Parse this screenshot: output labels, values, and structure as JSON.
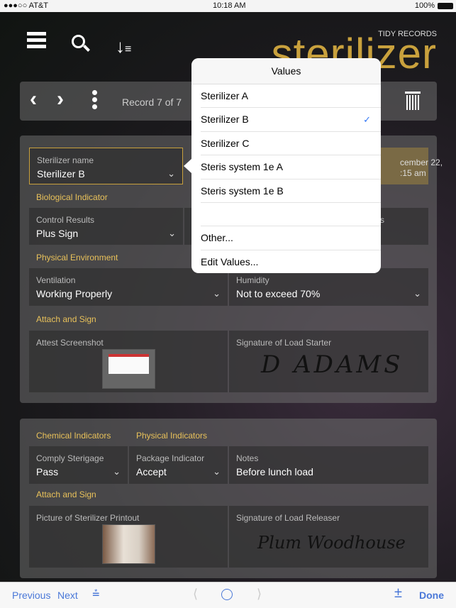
{
  "status_bar": {
    "carrier": "●●●○○ AT&T",
    "time": "10:18 AM",
    "battery": "100%"
  },
  "header": {
    "logo_small": "TIDY RECORDS",
    "logo_big": "sterilizer",
    "icons": [
      "menu-icon",
      "search-icon",
      "sort-icon"
    ]
  },
  "toolbar": {
    "record_text": "Record 7 of 7"
  },
  "record1": {
    "sterilizer_name": {
      "label": "Sterilizer name",
      "value": "Sterilizer B"
    },
    "date_fragment_1": "cember 22,",
    "date_fragment_2": ":15 am",
    "bio_section": "Biological Indicator",
    "control_results": {
      "label": "Control Results",
      "value": "Plus Sign"
    },
    "hidden_label_fragment": "s",
    "phys_section": "Physical Environment",
    "ventilation": {
      "label": "Ventilation",
      "value": "Working Properly"
    },
    "humidity": {
      "label": "Humidity",
      "value": "Not to exceed  70%"
    },
    "attach_section": "Attach and Sign",
    "attest": {
      "label": "Attest Screenshot"
    },
    "signature_starter": {
      "label": "Signature of Load Starter",
      "signature": "D ADAMS"
    }
  },
  "record2": {
    "chem_section": "Chemical Indicators",
    "phys_section": "Physical Indicators",
    "comply": {
      "label": "Comply Sterigage",
      "value": "Pass"
    },
    "package": {
      "label": "Package Indicator",
      "value": "Accept"
    },
    "notes": {
      "label": "Notes",
      "value": "Before lunch load"
    },
    "attach_section": "Attach and Sign",
    "printout": {
      "label": "Picture of Sterilizer Printout"
    },
    "signature_releaser": {
      "label": "Signature of Load Releaser",
      "signature": "Plum Woodhouse"
    }
  },
  "popover": {
    "title": "Values",
    "items": [
      "Sterilizer A",
      "Sterilizer B",
      "Sterilizer C",
      "Steris system 1e A",
      "Steris system 1e B",
      "",
      "Other...",
      "Edit Values..."
    ],
    "selected": "Sterilizer B",
    "check": "✓"
  },
  "bottom_bar": {
    "previous": "Previous",
    "next": "Next",
    "done": "Done"
  },
  "colors": {
    "accent": "#c9a13d",
    "section": "#e8c15a",
    "link": "#4a78d8",
    "check": "#3478f6"
  }
}
